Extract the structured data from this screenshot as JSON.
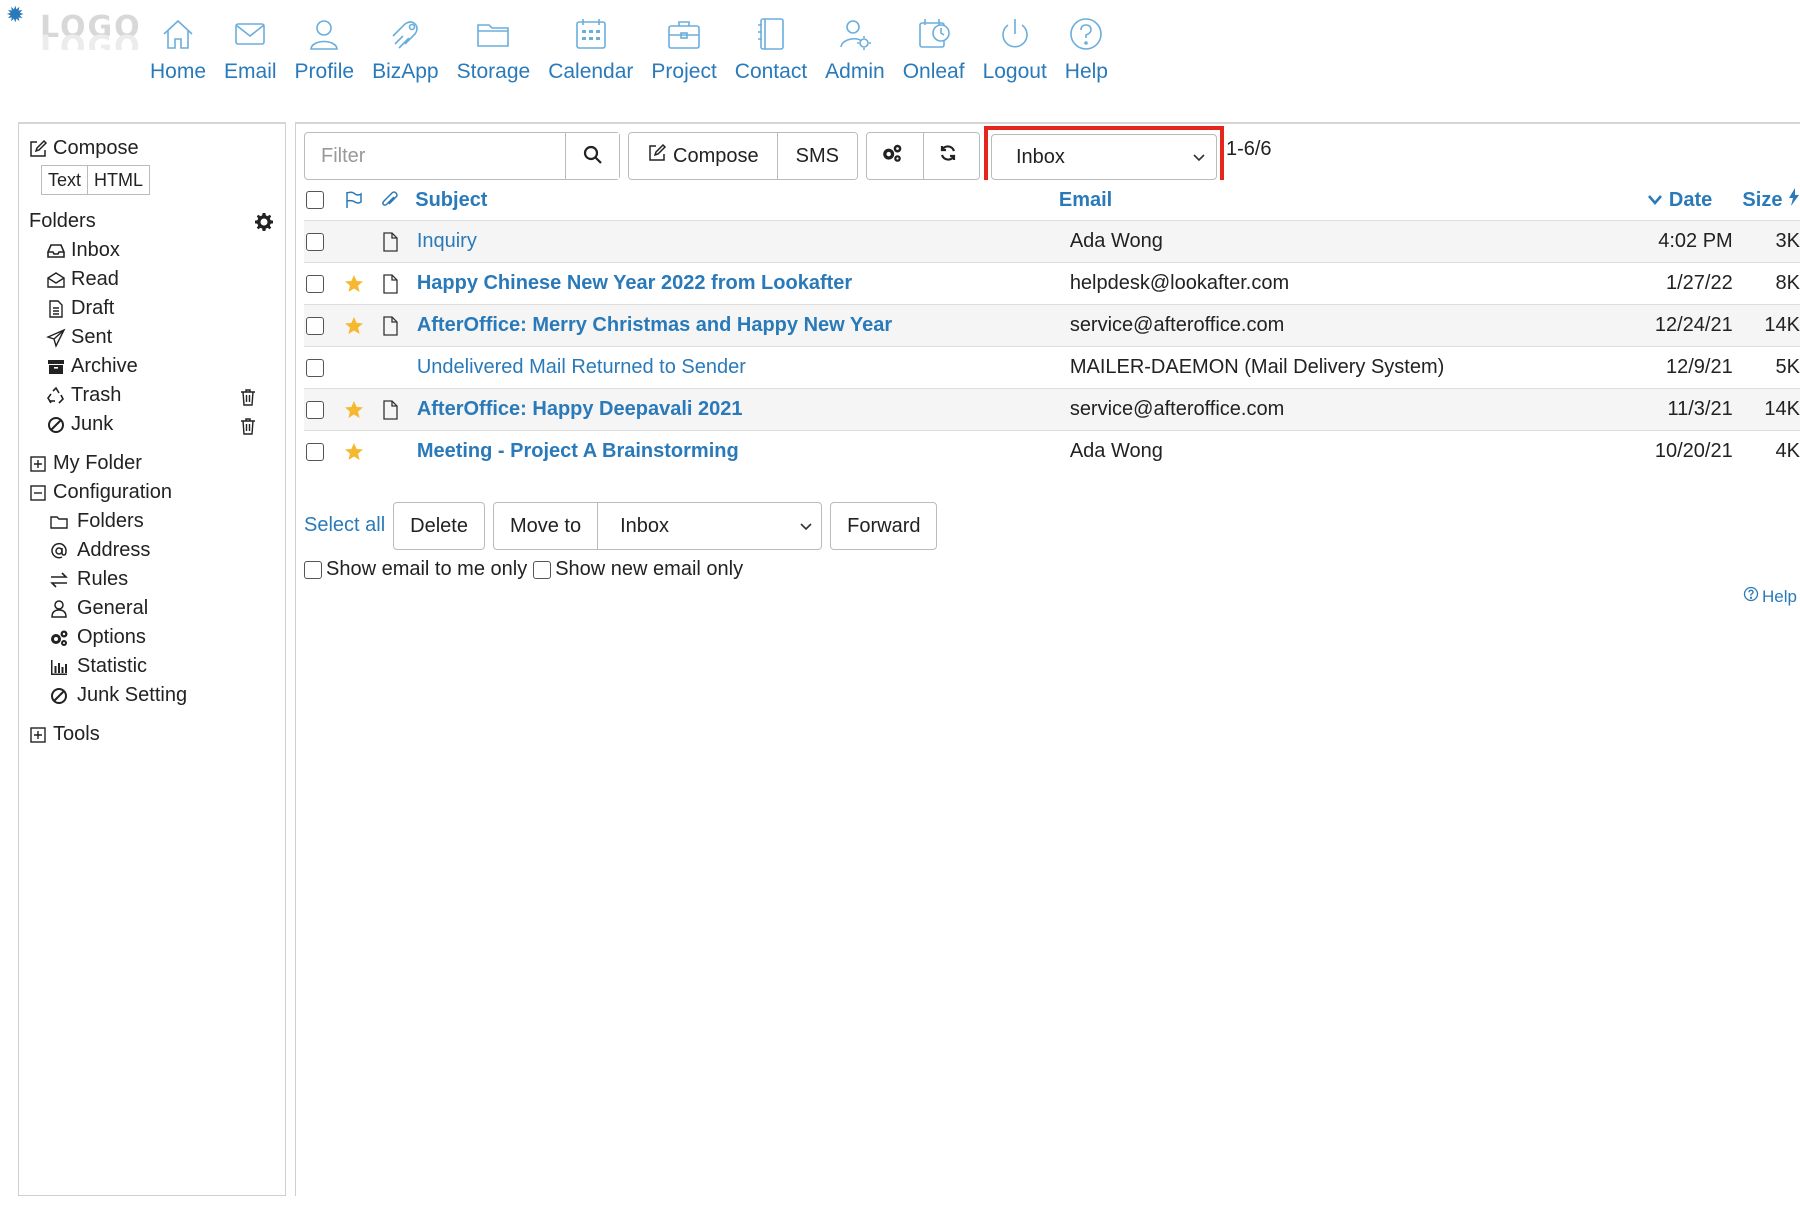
{
  "logo": {
    "text": "LOGO"
  },
  "nav": [
    {
      "label": "Home",
      "icon": "home-icon"
    },
    {
      "label": "Email",
      "icon": "email-icon"
    },
    {
      "label": "Profile",
      "icon": "profile-icon"
    },
    {
      "label": "BizApp",
      "icon": "bizapp-icon"
    },
    {
      "label": "Storage",
      "icon": "storage-icon"
    },
    {
      "label": "Calendar",
      "icon": "calendar-icon"
    },
    {
      "label": "Project",
      "icon": "project-icon"
    },
    {
      "label": "Contact",
      "icon": "contact-icon"
    },
    {
      "label": "Admin",
      "icon": "admin-icon"
    },
    {
      "label": "Onleaf",
      "icon": "onleaf-icon"
    },
    {
      "label": "Logout",
      "icon": "logout-icon"
    },
    {
      "label": "Help",
      "icon": "help-icon"
    }
  ],
  "sidebar": {
    "compose_label": "Compose",
    "format_text": "Text",
    "format_html": "HTML",
    "folders_label": "Folders",
    "folders": [
      {
        "label": "Inbox",
        "icon": "inbox-icon"
      },
      {
        "label": "Read",
        "icon": "envelope-open-icon"
      },
      {
        "label": "Draft",
        "icon": "draft-icon"
      },
      {
        "label": "Sent",
        "icon": "paper-plane-icon"
      },
      {
        "label": "Archive",
        "icon": "archive-icon"
      },
      {
        "label": "Trash",
        "icon": "recycle-icon",
        "action": "empty-trash-icon"
      },
      {
        "label": "Junk",
        "icon": "ban-icon",
        "action": "empty-junk-icon"
      }
    ],
    "my_folder_label": "My Folder",
    "configuration_label": "Configuration",
    "configuration": [
      {
        "label": "Folders",
        "icon": "folder-icon"
      },
      {
        "label": "Address",
        "icon": "at-icon"
      },
      {
        "label": "Rules",
        "icon": "exchange-icon"
      },
      {
        "label": "General",
        "icon": "user-icon"
      },
      {
        "label": "Options",
        "icon": "cogs-icon"
      },
      {
        "label": "Statistic",
        "icon": "bar-chart-icon"
      },
      {
        "label": "Junk Setting",
        "icon": "ban-icon"
      }
    ],
    "tools_label": "Tools"
  },
  "toolbar": {
    "filter_placeholder": "Filter",
    "compose_label": "Compose",
    "sms_label": "SMS",
    "folder_selected": "Inbox",
    "range": "1-6/6"
  },
  "table": {
    "headers": {
      "subject": "Subject",
      "email": "Email",
      "date": "Date",
      "size": "Size"
    },
    "rows": [
      {
        "starred": false,
        "doc": true,
        "bold": false,
        "subject": "Inquiry",
        "email": "Ada Wong",
        "date": "4:02 PM",
        "size": "3K"
      },
      {
        "starred": true,
        "doc": true,
        "bold": true,
        "subject": "Happy Chinese New Year 2022 from Lookafter",
        "email": "helpdesk@lookafter.com",
        "date": "1/27/22",
        "size": "8K"
      },
      {
        "starred": true,
        "doc": true,
        "bold": true,
        "subject": "AfterOffice: Merry Christmas and Happy New Year",
        "email": "service@afteroffice.com",
        "date": "12/24/21",
        "size": "14K"
      },
      {
        "starred": false,
        "doc": false,
        "bold": false,
        "subject": "Undelivered Mail Returned to Sender",
        "email": "MAILER-DAEMON (Mail Delivery System)",
        "date": "12/9/21",
        "size": "5K"
      },
      {
        "starred": true,
        "doc": true,
        "bold": true,
        "subject": "AfterOffice: Happy Deepavali 2021",
        "email": "service@afteroffice.com",
        "date": "11/3/21",
        "size": "14K"
      },
      {
        "starred": true,
        "doc": false,
        "bold": true,
        "subject": "Meeting - Project A Brainstorming",
        "email": "Ada Wong",
        "date": "10/20/21",
        "size": "4K"
      }
    ]
  },
  "actions": {
    "select_all": "Select all",
    "delete": "Delete",
    "move_to": "Move to",
    "move_target": "Inbox",
    "forward": "Forward",
    "show_to_me": "Show email to me only",
    "show_new": "Show new email only",
    "help": "Help"
  },
  "colors": {
    "link": "#2a7ab9",
    "star": "#f5b82e",
    "highlight": "#e5261c"
  }
}
